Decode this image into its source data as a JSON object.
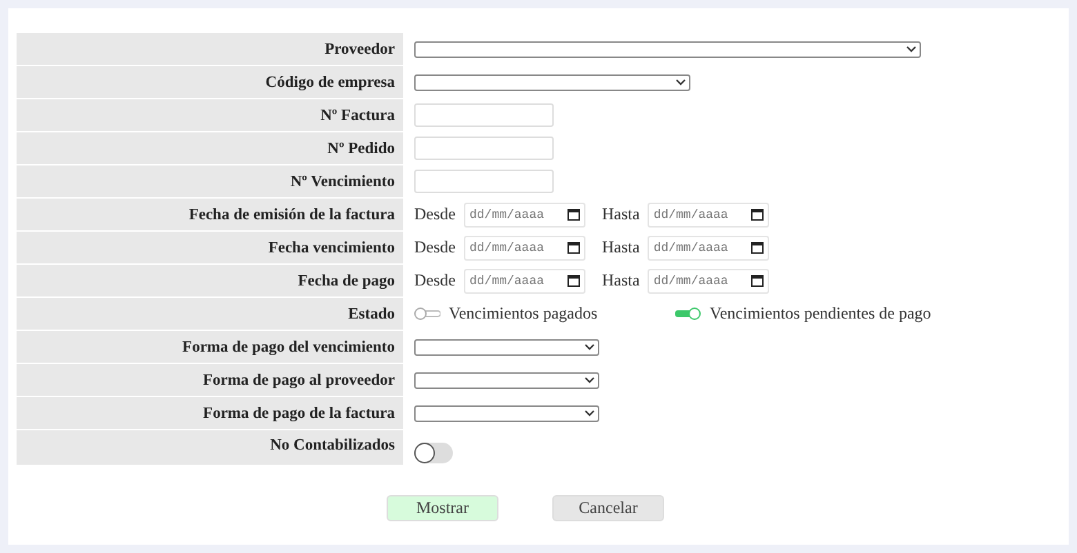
{
  "form": {
    "rows": [
      {
        "kind": "select",
        "label": "Proveedor"
      },
      {
        "kind": "select",
        "label": "Código de empresa"
      },
      {
        "kind": "text",
        "label": "Nº Factura"
      },
      {
        "kind": "text",
        "label": "Nº Pedido"
      },
      {
        "kind": "text",
        "label": "Nº Vencimiento"
      },
      {
        "kind": "daterange",
        "label": "Fecha de emisión de la factura",
        "from_label": "Desde",
        "from_placeholder": "dd/mm/aaaa",
        "to_label": "Hasta",
        "to_placeholder": "dd/mm/aaaa"
      },
      {
        "kind": "daterange",
        "label": "Fecha vencimiento",
        "from_label": "Desde",
        "from_placeholder": "dd/mm/aaaa",
        "to_label": "Hasta",
        "to_placeholder": "dd/mm/aaaa"
      },
      {
        "kind": "daterange",
        "label": "Fecha de pago",
        "from_label": "Desde",
        "from_placeholder": "dd/mm/aaaa",
        "to_label": "Hasta",
        "to_placeholder": "dd/mm/aaaa"
      },
      {
        "kind": "choice",
        "label": "Estado",
        "options": [
          {
            "label": "Vencimientos pagados",
            "selected": false
          },
          {
            "label": "Vencimientos pendientes de pago",
            "selected": true
          }
        ]
      },
      {
        "kind": "select",
        "label": "Forma de pago del vencimiento"
      },
      {
        "kind": "select",
        "label": "Forma de pago al proveedor"
      },
      {
        "kind": "select",
        "label": "Forma de pago de la factura"
      },
      {
        "kind": "switch",
        "label": "No Contabilizados",
        "on": false
      }
    ]
  },
  "buttons": [
    {
      "label": "Mostrar",
      "kind": "primary"
    },
    {
      "label": "Cancelar",
      "kind": "secondary"
    }
  ]
}
